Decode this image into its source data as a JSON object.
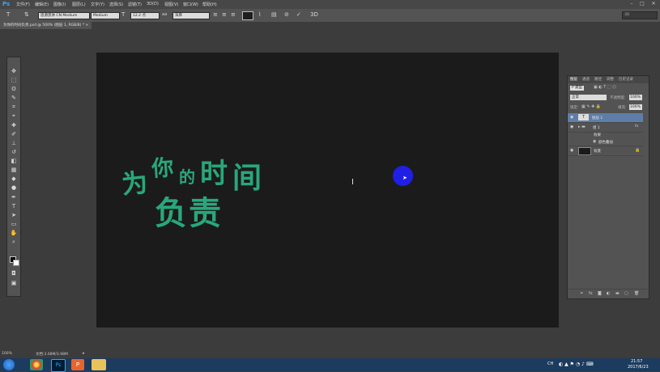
{
  "app": {
    "logo": "Ps"
  },
  "menu": [
    "文件(F)",
    "编辑(E)",
    "图像(I)",
    "图层(L)",
    "文字(Y)",
    "选择(S)",
    "滤镜(T)",
    "3D(D)",
    "视图(V)",
    "窗口(W)",
    "帮助(H)"
  ],
  "options": {
    "font_family": "思源黑体 CN Medium",
    "font_style": "Medium",
    "font_size": "12.2 点",
    "aa_mode": "浑厚",
    "workspace": "3D",
    "text_color": "#1e1e1e"
  },
  "document": {
    "tab_title": "为你的时间负责.psd @ 500% (图层 1, RGB/8) *"
  },
  "canvas": {
    "line1": [
      "为",
      "你",
      "的",
      "时",
      "间"
    ],
    "line2": "负责",
    "text_color": "#29a77b",
    "click_marker_color": "#1f1fe6"
  },
  "status": {
    "zoom": "100%",
    "doc_size": "文档:3.08M/3.98M"
  },
  "panel": {
    "tabs": [
      "图层",
      "通道",
      "路径",
      "调整",
      "历史记录"
    ],
    "filter_label": "P 类型",
    "blend_mode": "正常",
    "opacity_label": "不透明度:",
    "opacity_value": "100%",
    "lock_label": "锁定:",
    "fill_label": "填充:",
    "fill_value": "100%",
    "layers": [
      {
        "name": "图层 1",
        "selected": true
      },
      {
        "name": "组 1"
      },
      {
        "name": "效果"
      },
      {
        "name": "颜色叠加"
      },
      {
        "name": "背景"
      }
    ]
  },
  "taskbar": {
    "time": "21:57",
    "date": "2017/6/23",
    "lang": "CH"
  }
}
